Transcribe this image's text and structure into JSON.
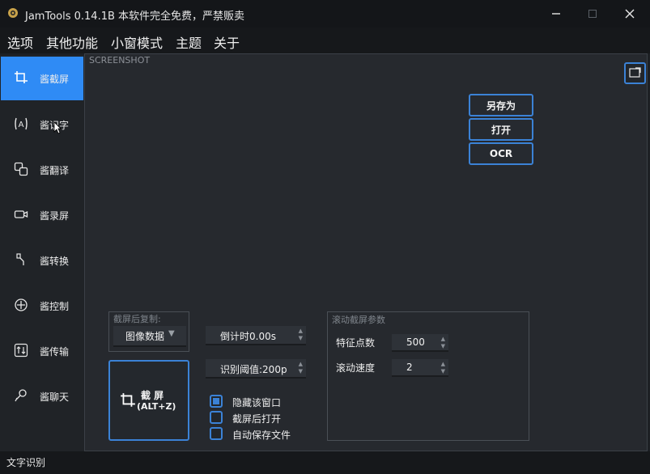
{
  "window": {
    "title": "JamTools 0.14.1B 本软件完全免费，严禁贩卖",
    "controls": [
      "minimize",
      "maximize",
      "close"
    ]
  },
  "menu": [
    "选项",
    "其他功能",
    "小窗模式",
    "主题",
    "关于"
  ],
  "sidebar": {
    "items": [
      {
        "label": "酱截屏",
        "icon": "crop-icon",
        "active": true
      },
      {
        "label": "酱识字",
        "icon": "text-recognize-icon",
        "active": false
      },
      {
        "label": "酱翻译",
        "icon": "translate-icon",
        "active": false
      },
      {
        "label": "酱录屏",
        "icon": "video-icon",
        "active": false
      },
      {
        "label": "酱转换",
        "icon": "convert-icon",
        "active": false
      },
      {
        "label": "酱控制",
        "icon": "control-icon",
        "active": false
      },
      {
        "label": "酱传输",
        "icon": "transfer-icon",
        "active": false
      },
      {
        "label": "酱聊天",
        "icon": "chat-icon",
        "active": false
      }
    ]
  },
  "main": {
    "title": "SCREENSHOT",
    "actions": {
      "save_as": "另存为",
      "open": "打开",
      "ocr": "OCR"
    },
    "copy_group": {
      "title": "截屏后复制:",
      "selected": "图像数据"
    },
    "countdown": "倒计时0.00s",
    "threshold": "识别阈值:200p",
    "capture_button": {
      "label": "截 屏",
      "shortcut": "(ALT+Z)"
    },
    "checkboxes": [
      {
        "label": "隐藏该窗口",
        "checked": true
      },
      {
        "label": "截屏后打开",
        "checked": false
      },
      {
        "label": "自动保存文件",
        "checked": false
      }
    ],
    "scroll_group": {
      "title": "滚动截屏参数",
      "feature_points_label": "特征点数",
      "feature_points_value": "500",
      "scroll_speed_label": "滚动速度",
      "scroll_speed_value": "2"
    }
  },
  "status": "文字识别",
  "colors": {
    "accent": "#3b82d6",
    "active_tab": "#2f8bf5",
    "background": "#1d2024",
    "panel": "#26292e"
  }
}
